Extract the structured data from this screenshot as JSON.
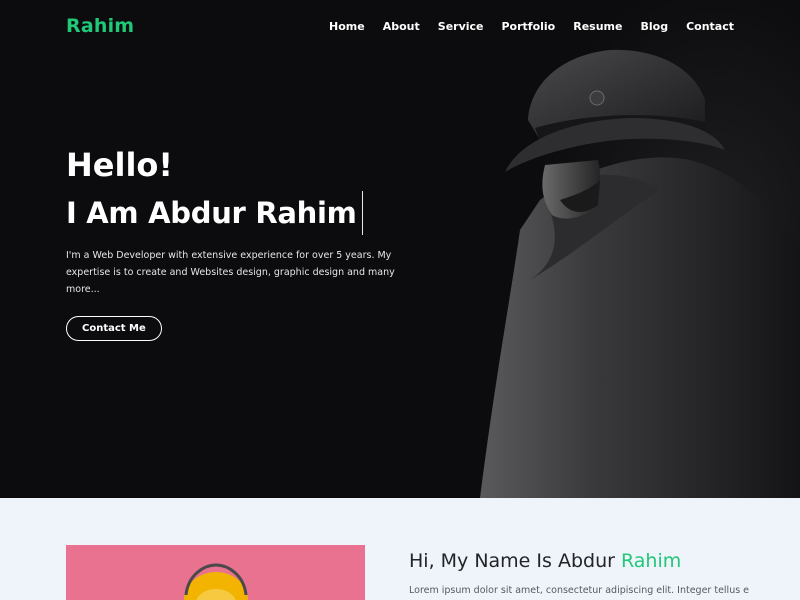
{
  "brand": {
    "logo": "Rahim",
    "accent_color": "#20c878"
  },
  "nav": {
    "items": [
      {
        "label": "Home"
      },
      {
        "label": "About"
      },
      {
        "label": "Service"
      },
      {
        "label": "Portfolio"
      },
      {
        "label": "Resume"
      },
      {
        "label": "Blog"
      },
      {
        "label": "Contact"
      }
    ]
  },
  "hero": {
    "greeting": "Hello!",
    "name_line": "I Am Abdur Rahim",
    "description": "I'm a Web Developer with extensive experience for over 5 years. My expertise is to create and Websites design, graphic design and many more...",
    "cta_label": "Contact Me",
    "background_color": "#0c0c0e"
  },
  "about": {
    "title_prefix": "Hi, My Name Is Abdur ",
    "title_accent": "Rahim",
    "text": "Lorem ipsum dolor sit amet, consectetur adipiscing elit. Integer tellus est, finibus ut",
    "background_color": "#eef4fa",
    "photo_background": "#e8728f"
  }
}
